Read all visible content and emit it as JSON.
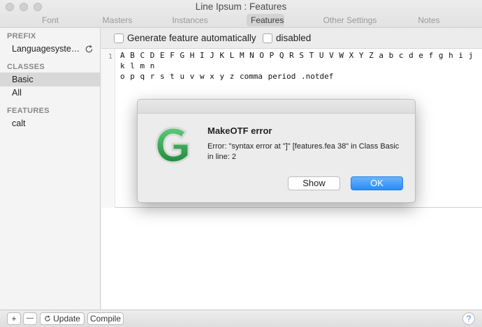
{
  "window": {
    "title": "Line Ipsum : Features",
    "tabs": [
      "Font",
      "Masters",
      "Instances",
      "Features",
      "Other Settings",
      "Notes"
    ],
    "active_tab": "Features"
  },
  "sidebar": {
    "prefix_header": "PREFIX",
    "prefix_items": [
      {
        "label": "Languagesyste…",
        "icon": "refresh-icon"
      }
    ],
    "classes_header": "CLASSES",
    "class_items": [
      {
        "label": "Basic",
        "selected": true
      },
      {
        "label": "All",
        "selected": false
      }
    ],
    "features_header": "FEATURES",
    "feature_items": [
      {
        "label": "calt"
      }
    ]
  },
  "options": {
    "generate_label": "Generate feature automatically",
    "generate_checked": false,
    "disabled_label": "disabled",
    "disabled_checked": false
  },
  "editor": {
    "line_numbers": [
      "1"
    ],
    "code_line1": "A B C D E F G H I J K L M N O P Q R S T U V W X Y Z a b c d e f g h i j k l m n",
    "code_line2": "o p q r s t u v w x y z comma period .notdef"
  },
  "bottombar": {
    "add_label": "+",
    "remove_label": "—",
    "update_label": "Update",
    "compile_label": "Compile",
    "help_label": "?"
  },
  "dialog": {
    "title": "MakeOTF error",
    "message": "Error: \"syntax error at \"]\" [features.fea 38\" in Class Basic in line: 2",
    "show_label": "Show",
    "ok_label": "OK",
    "icon": "glyphs-app-icon",
    "accent_color": "#2a8cf5",
    "icon_color": "#2fa84f"
  }
}
